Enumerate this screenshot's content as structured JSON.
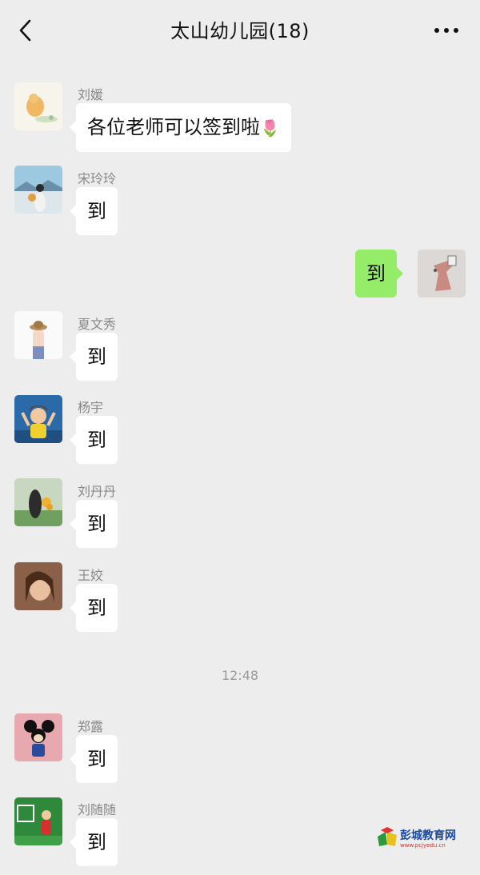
{
  "header": {
    "title": "太山幼儿园(18)"
  },
  "messages": [
    {
      "sender": "刘媛",
      "text": "各位老师可以签到啦",
      "emoji": "🌷"
    },
    {
      "sender": "宋玲玲",
      "text": "到"
    },
    {
      "sender": "",
      "text": "到",
      "mine": true
    },
    {
      "sender": "夏文秀",
      "text": "到"
    },
    {
      "sender": "杨宇",
      "text": "到"
    },
    {
      "sender": "刘丹丹",
      "text": "到"
    },
    {
      "sender": "王姣",
      "text": "到"
    },
    {
      "sender": "郑露",
      "text": "到"
    },
    {
      "sender": "刘随随",
      "text": "到"
    }
  ],
  "timestamp": "12:48",
  "watermark": {
    "name": "彭城教育网",
    "url": "www.pcjyedu.cn"
  },
  "colors": {
    "background": "#ededed",
    "my_bubble": "#95ec69",
    "other_bubble": "#ffffff"
  }
}
